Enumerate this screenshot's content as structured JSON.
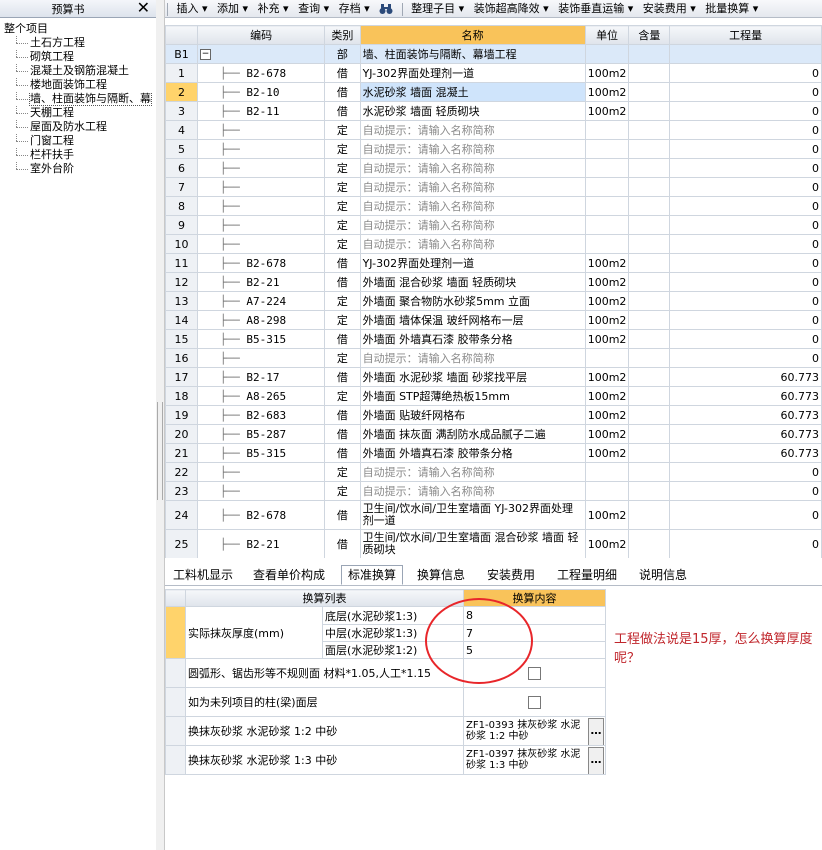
{
  "left_panel": {
    "title": "预算书",
    "close": "✕",
    "tree_root": "整个项目",
    "tree_items": [
      "土石方工程",
      "砌筑工程",
      "混凝土及钢筋混凝土",
      "楼地面装饰工程",
      "墙、柱面装饰与隔断、幕",
      "天棚工程",
      "屋面及防水工程",
      "门窗工程",
      "栏杆扶手",
      "室外台阶"
    ],
    "selected_index": 4
  },
  "toolbar": [
    "插入 ▾",
    "添加 ▾",
    "补充 ▾",
    "查询 ▾",
    "存档 ▾",
    "整理子目 ▾",
    "装饰超高降效 ▾",
    "装饰垂直运输 ▾",
    "安装费用 ▾",
    "批量换算 ▾"
  ],
  "grid": {
    "headers": {
      "code": "编码",
      "type": "类别",
      "name": "名称",
      "unit": "单位",
      "content": "含量",
      "qty": "工程量"
    },
    "section_row": {
      "num": "B1",
      "type": "部",
      "name": "墙、柱面装饰与隔断、幕墙工程"
    },
    "rows": [
      {
        "num": "1",
        "code": "B2-678",
        "type": "借",
        "name": "YJ-302界面处理剂一道",
        "unit": "100m2",
        "qty": "0"
      },
      {
        "num": "2",
        "code": "B2-10",
        "type": "借",
        "name": "水泥砂浆 墙面 混凝土",
        "unit": "100m2",
        "qty": "0"
      },
      {
        "num": "3",
        "code": "B2-11",
        "type": "借",
        "name": "水泥砂浆 墙面 轻质砌块",
        "unit": "100m2",
        "qty": "0"
      },
      {
        "num": "4",
        "code": "",
        "type": "定",
        "name": "自动提示：请输入名称简称",
        "unit": "",
        "qty": "0"
      },
      {
        "num": "5",
        "code": "",
        "type": "定",
        "name": "自动提示：请输入名称简称",
        "unit": "",
        "qty": "0"
      },
      {
        "num": "6",
        "code": "",
        "type": "定",
        "name": "自动提示：请输入名称简称",
        "unit": "",
        "qty": "0"
      },
      {
        "num": "7",
        "code": "",
        "type": "定",
        "name": "自动提示：请输入名称简称",
        "unit": "",
        "qty": "0"
      },
      {
        "num": "8",
        "code": "",
        "type": "定",
        "name": "自动提示：请输入名称简称",
        "unit": "",
        "qty": "0"
      },
      {
        "num": "9",
        "code": "",
        "type": "定",
        "name": "自动提示：请输入名称简称",
        "unit": "",
        "qty": "0"
      },
      {
        "num": "10",
        "code": "",
        "type": "定",
        "name": "自动提示：请输入名称简称",
        "unit": "",
        "qty": "0"
      },
      {
        "num": "11",
        "code": "B2-678",
        "type": "借",
        "name": "YJ-302界面处理剂一道",
        "unit": "100m2",
        "qty": "0"
      },
      {
        "num": "12",
        "code": "B2-21",
        "type": "借",
        "name": "外墙面 混合砂浆 墙面 轻质砌块",
        "unit": "100m2",
        "qty": "0"
      },
      {
        "num": "13",
        "code": "A7-224",
        "type": "定",
        "name": "外墙面 聚合物防水砂浆5mm 立面",
        "unit": "100m2",
        "qty": "0"
      },
      {
        "num": "14",
        "code": "A8-298",
        "type": "定",
        "name": "外墙面 墙体保温 玻纤网格布一层",
        "unit": "100m2",
        "qty": "0"
      },
      {
        "num": "15",
        "code": "B5-315",
        "type": "借",
        "name": "外墙面 外墙真石漆 胶带条分格",
        "unit": "100m2",
        "qty": "0"
      },
      {
        "num": "16",
        "code": "",
        "type": "定",
        "name": "自动提示：请输入名称简称",
        "unit": "",
        "qty": "0"
      },
      {
        "num": "17",
        "code": "B2-17",
        "type": "借",
        "name": "外墙面 水泥砂浆 墙面 砂浆找平层",
        "unit": "100m2",
        "qty": "60.773"
      },
      {
        "num": "18",
        "code": "A8-265",
        "type": "定",
        "name": "外墙面 STP超薄绝热板15mm",
        "unit": "100m2",
        "qty": "60.773"
      },
      {
        "num": "19",
        "code": "B2-683",
        "type": "借",
        "name": "外墙面 贴玻纤网格布",
        "unit": "100m2",
        "qty": "60.773"
      },
      {
        "num": "20",
        "code": "B5-287",
        "type": "借",
        "name": "外墙面 抹灰面 满刮防水成品腻子二遍",
        "unit": "100m2",
        "qty": "60.773"
      },
      {
        "num": "21",
        "code": "B5-315",
        "type": "借",
        "name": "外墙面 外墙真石漆 胶带条分格",
        "unit": "100m2",
        "qty": "60.773"
      },
      {
        "num": "22",
        "code": "",
        "type": "定",
        "name": "自动提示：请输入名称简称",
        "unit": "",
        "qty": "0"
      },
      {
        "num": "23",
        "code": "",
        "type": "定",
        "name": "自动提示：请输入名称简称",
        "unit": "",
        "qty": "0"
      },
      {
        "num": "24",
        "code": "B2-678",
        "type": "借",
        "name": "卫生间/饮水间/卫生室墙面 YJ-302界面处理剂一道",
        "unit": "100m2",
        "qty": "0"
      },
      {
        "num": "25",
        "code": "B2-21",
        "type": "借",
        "name": "卫生间/饮水间/卫生室墙面 混合砂浆 墙面 轻质砌块",
        "unit": "100m2",
        "qty": "0"
      }
    ]
  },
  "tabs": [
    "工料机显示",
    "查看单价构成",
    "标准换算",
    "换算信息",
    "安装费用",
    "工程量明细",
    "说明信息"
  ],
  "active_tab": 2,
  "conversion": {
    "header_list": "换算列表",
    "header_content": "换算内容",
    "group_label": "实际抹灰厚度(mm)",
    "layers": [
      {
        "label": "底层(水泥砂浆1:3)",
        "value": "8"
      },
      {
        "label": "中层(水泥砂浆1:3)",
        "value": "7"
      },
      {
        "label": "面层(水泥砂浆1:2)",
        "value": "5"
      }
    ],
    "option1": "圆弧形、锯齿形等不规则面 材料*1.05,人工*1.15",
    "option2": "如为未列项目的柱(梁)面层",
    "replace1_label": "换抹灰砂浆 水泥砂浆 1:2 中砂",
    "replace1_value": "ZF1-0393 抹灰砂浆 水泥砂浆 1:2 中砂",
    "replace2_label": "换抹灰砂浆 水泥砂浆 1:3 中砂",
    "replace2_value": "ZF1-0397 抹灰砂浆 水泥砂浆 1:3 中砂"
  },
  "annotation": {
    "text": "工程做法说是15厚，怎么换算厚度呢？",
    "color": "#c0262c"
  },
  "icons": {
    "search": "binoculars-icon",
    "ellipsis": "…"
  }
}
